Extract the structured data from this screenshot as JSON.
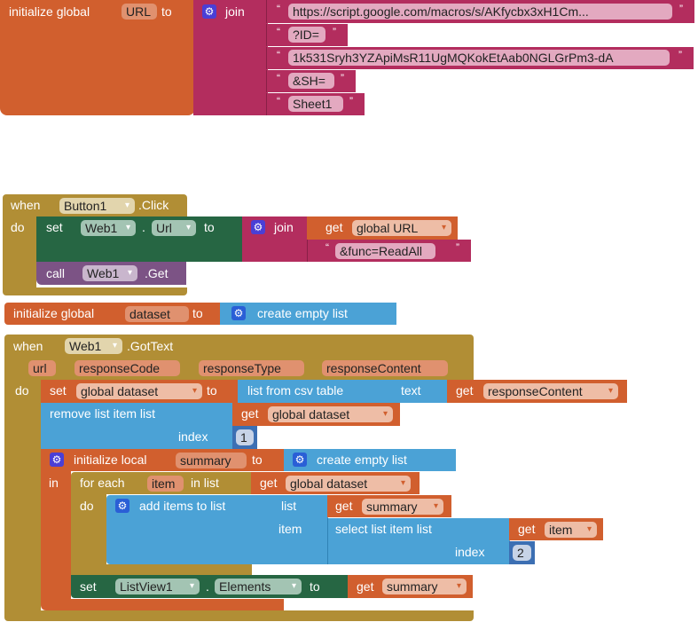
{
  "colors": {
    "variables": "#d15f2e",
    "text": "#b32d5e",
    "control": "#b18e35",
    "component_set": "#266643",
    "component_call": "#7c5385",
    "lists": "#4ba2d6",
    "math": "#3c6fb3"
  },
  "block1": {
    "init": "initialize global",
    "name": "URL",
    "to": "to",
    "join": "join",
    "strings": [
      "https://script.google.com/macros/s/AKfycbx3xH1Cm...",
      "?ID=",
      "1k531Sryh3YZApiMsR11UgMQKokEtAab0NGLGrPm3-dA",
      "&SH=",
      "Sheet1"
    ]
  },
  "block2": {
    "when": "when",
    "component": "Button1",
    "event": ".Click",
    "do": "do",
    "set": "set",
    "set_component": "Web1",
    "dot": ".",
    "property": "Url",
    "to": "to",
    "join": "join",
    "get": "get",
    "get_var": "global URL",
    "string": "&func=ReadAll",
    "call": "call",
    "call_component": "Web1",
    "method": ".Get"
  },
  "block3": {
    "init": "initialize global",
    "name": "dataset",
    "to": "to",
    "value": "create empty list"
  },
  "block4": {
    "when": "when",
    "component": "Web1",
    "event": ".GotText",
    "params": [
      "url",
      "responseCode",
      "responseType",
      "responseContent"
    ],
    "do": "do",
    "set": "set",
    "set_var": "global dataset",
    "to": "to",
    "csv": "list from csv table",
    "text": "text",
    "get": "get",
    "get_content": "responseContent",
    "remove": "remove list item  list",
    "remove_var": "global dataset",
    "index": "index",
    "index1": "1",
    "init_local": "initialize local",
    "local_name": "summary",
    "in": "in",
    "empty": "create empty list",
    "foreach": "for each",
    "item": "item",
    "inlist": "in list",
    "foreach_var": "global dataset",
    "foreach_do": "do",
    "add": "add items to list",
    "list": "list",
    "item_label": "item",
    "add_var": "summary",
    "select": "select list item  list",
    "select_var": "item",
    "index2": "2",
    "set2": "set",
    "set2_component": "ListView1",
    "dot": ".",
    "set2_property": "Elements",
    "set2_var": "summary"
  }
}
